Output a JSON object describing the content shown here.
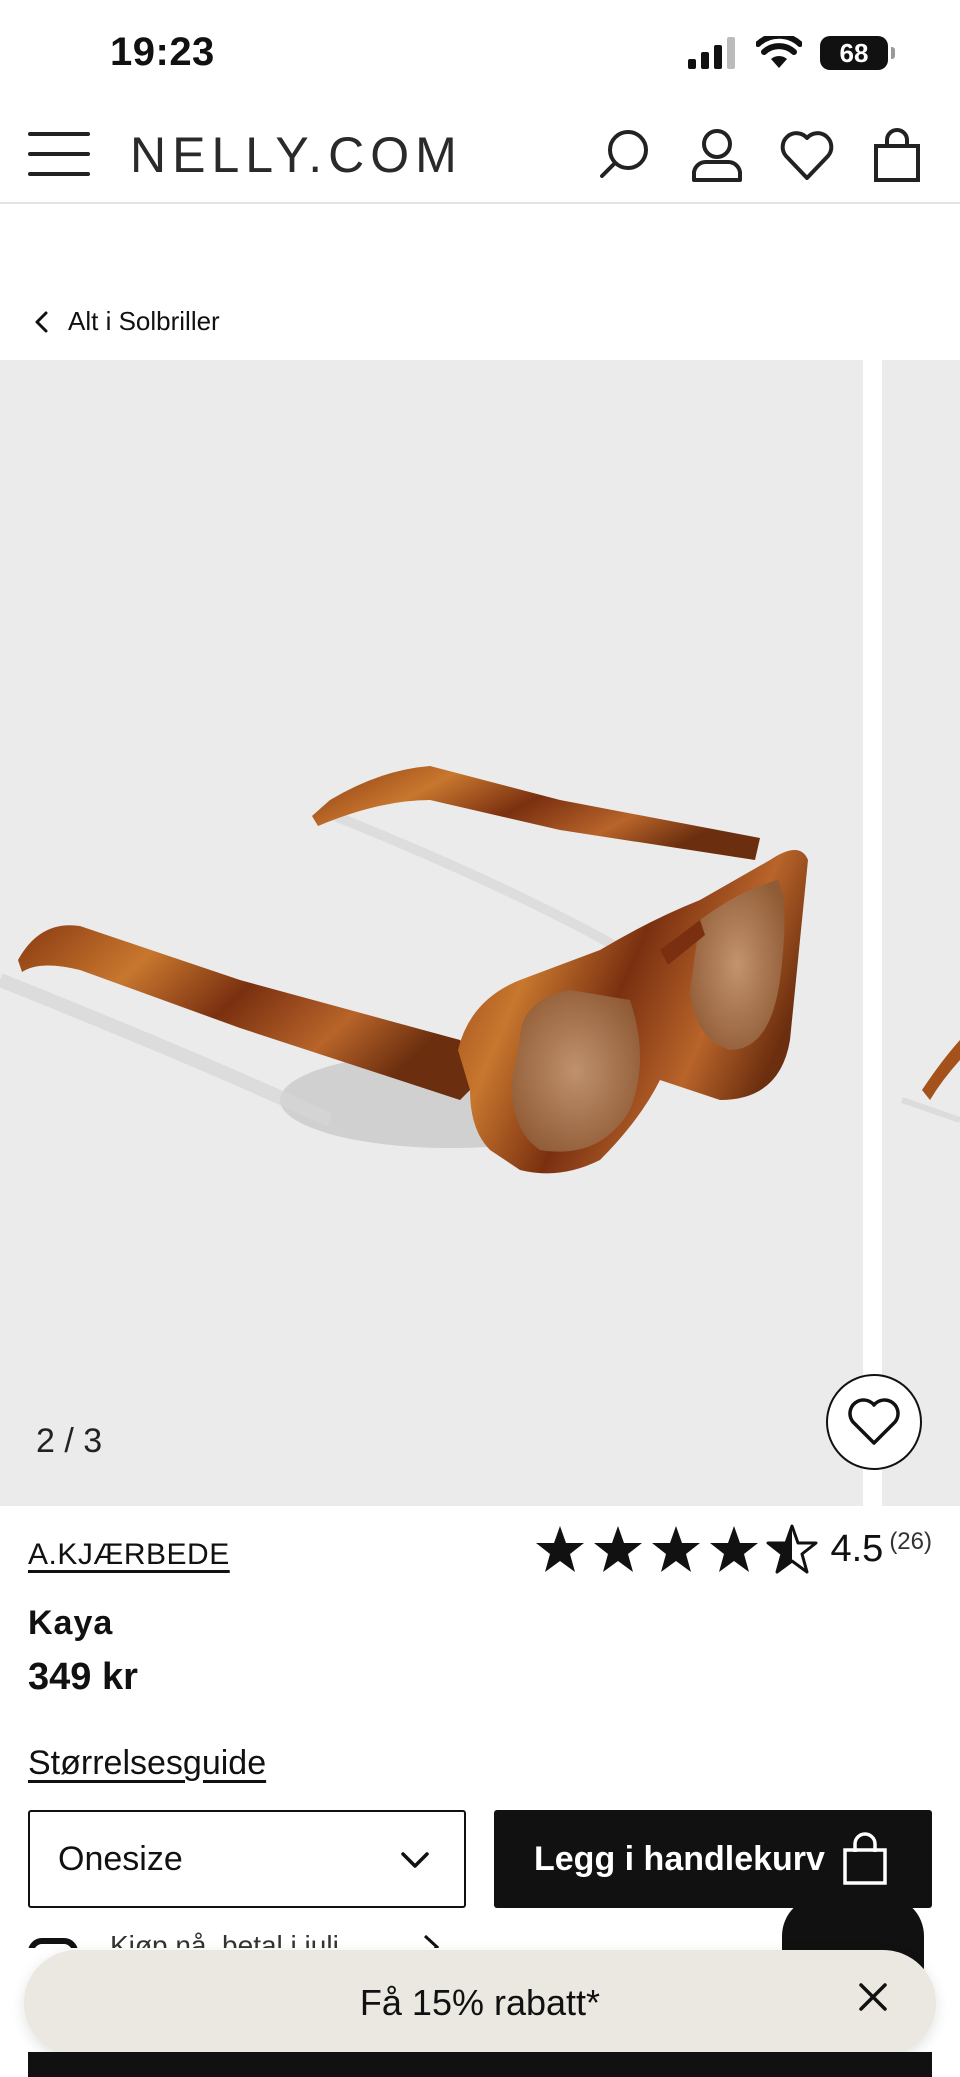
{
  "status_bar": {
    "time": "19:23",
    "battery": "68"
  },
  "header": {
    "logo": "NELLY.COM"
  },
  "breadcrumb": {
    "label": "Alt i Solbriller"
  },
  "gallery": {
    "counter": "2 / 3"
  },
  "product": {
    "brand": "A.KJÆRBEDE",
    "name": "Kaya",
    "price": "349 kr",
    "rating": 4.5,
    "rating_value": "4.5",
    "rating_count": "(26)",
    "size_guide": "Størrelsesguide",
    "size_selected": "Onesize",
    "add_to_cart": "Legg i handlekurv"
  },
  "klarna": {
    "text": "Kjøp nå, betal i juli"
  },
  "promo": {
    "text": "Få 15% rabatt*"
  },
  "colors": {
    "tortoise_dark": "#6b2e0e",
    "tortoise_mid": "#a4511c",
    "tortoise_light": "#c8772e",
    "lens": "#a97a55"
  }
}
